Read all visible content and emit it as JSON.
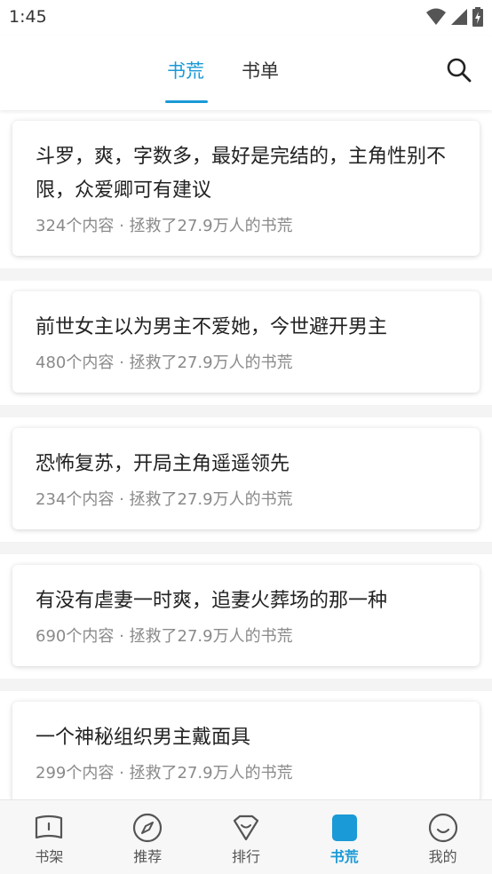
{
  "status_bar": {
    "time": "1:45",
    "icons": [
      "wifi-icon",
      "signal-icon",
      "battery-icon"
    ]
  },
  "header": {
    "tabs": [
      {
        "label": "书荒",
        "active": true
      },
      {
        "label": "书单",
        "active": false
      }
    ],
    "search_icon": "search-icon"
  },
  "cards": [
    {
      "title": "斗罗，爽，字数多，最好是完结的，主角性别不限，众爱卿可有建议",
      "meta": "324个内容 · 拯救了27.9万人的书荒"
    },
    {
      "title": "前世女主以为男主不爱她，今世避开男主",
      "meta": "480个内容 · 拯救了27.9万人的书荒"
    },
    {
      "title": "恐怖复苏，开局主角遥遥领先",
      "meta": "234个内容 · 拯救了27.9万人的书荒"
    },
    {
      "title": "有没有虐妻一时爽，追妻火葬场的那一种",
      "meta": "690个内容 · 拯救了27.9万人的书荒"
    },
    {
      "title": "一个神秘组织男主戴面具",
      "meta": "299个内容 · 拯救了27.9万人的书荒"
    }
  ],
  "bottom_nav": [
    {
      "label": "书架",
      "icon": "bookshelf-icon",
      "active": false
    },
    {
      "label": "推荐",
      "icon": "compass-icon",
      "active": false
    },
    {
      "label": "排行",
      "icon": "ranking-icon",
      "active": false
    },
    {
      "label": "书荒",
      "icon": "book-shortage-icon",
      "active": true
    },
    {
      "label": "我的",
      "icon": "smiley-icon",
      "active": false
    }
  ],
  "colors": {
    "accent": "#1a9ad6",
    "meta_text": "#8a8a8a",
    "background": "#f4f4f4"
  }
}
